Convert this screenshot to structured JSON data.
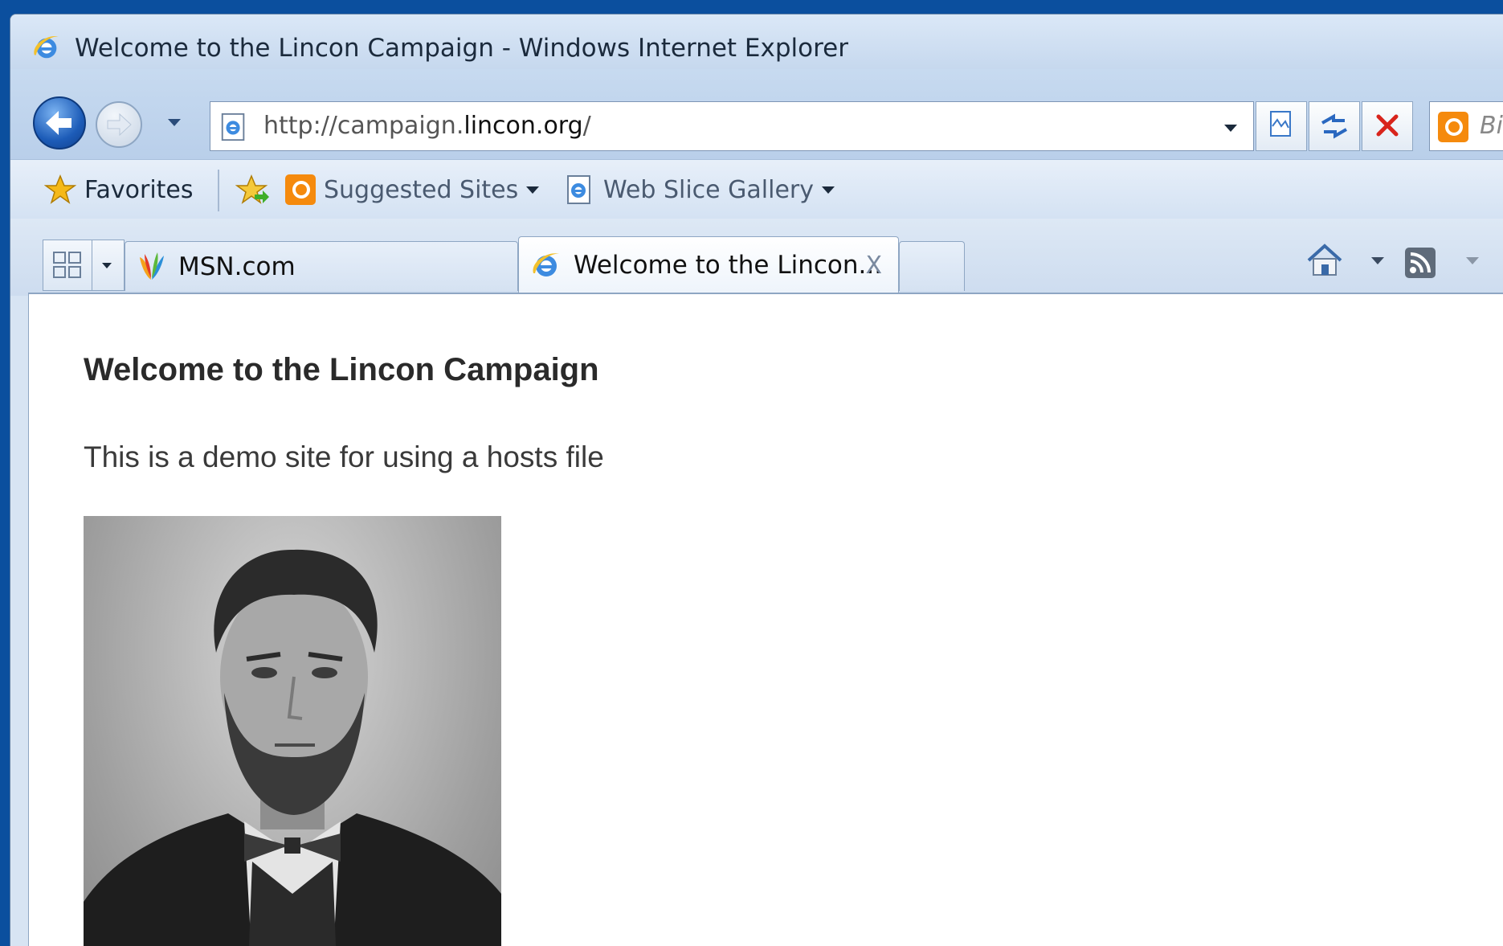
{
  "window": {
    "title": "Welcome to the Lincon Campaign - Windows Internet Explorer"
  },
  "address_bar": {
    "url_prefix": "http://campaign.",
    "url_domain": "lincon.org",
    "url_suffix": "/"
  },
  "search": {
    "partial_text": "Bi"
  },
  "favorites_bar": {
    "favorites_label": "Favorites",
    "suggested_sites_label": "Suggested Sites",
    "web_slice_gallery_label": "Web Slice Gallery"
  },
  "tabs": [
    {
      "label": "MSN.com"
    },
    {
      "label": "Welcome to the Lincon..."
    }
  ],
  "tab_close_glyph": "X",
  "page": {
    "heading": "Welcome to the Lincon Campaign",
    "text": "This is a demo site for using a hosts file"
  },
  "colors": {
    "accent": "#1d5cb8",
    "bing_orange": "#f58a0d",
    "stop_red": "#d8241c"
  }
}
